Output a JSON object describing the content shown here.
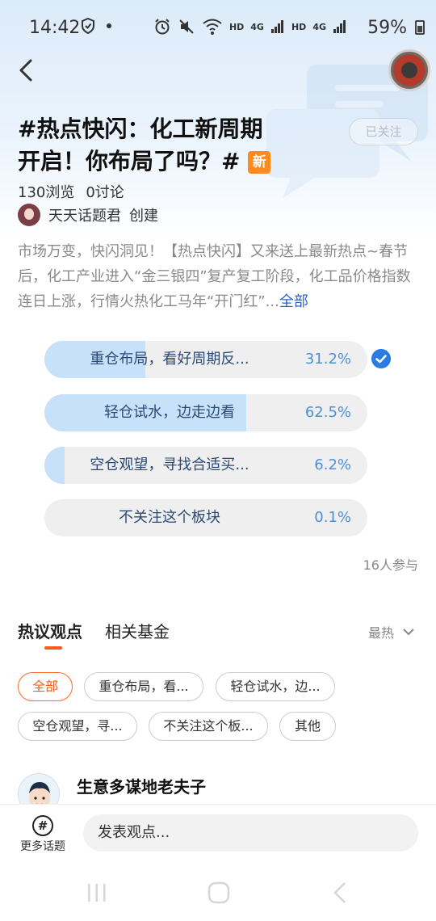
{
  "status_bar": {
    "time": "14:42",
    "hd1": "HD",
    "lte1": "4G",
    "hd2": "HD",
    "lte2": "4G",
    "battery": "59%"
  },
  "topic": {
    "title_line1": "#热点快闪：化工新周期",
    "title_line2": "开启！你布局了吗？#",
    "new_badge": "新",
    "follow_label": "已关注",
    "views": "130浏览",
    "discussions": "0讨论",
    "creator_name": "天天话题君",
    "creator_action": "创建",
    "description": "市场万变，快闪洞见！【热点快闪】又来送上最新热点~春节后，化工产业进入“金三银四”复产复工阶段，化工品价格指数连日上涨，行情火热化工马年“开门红”...",
    "description_more": "全部"
  },
  "poll": {
    "options": [
      {
        "label": "重仓布局，看好周期反...",
        "percent_text": "31.2%",
        "fill": 0.312,
        "selected": true
      },
      {
        "label": "轻仓试水，边走边看",
        "percent_text": "62.5%",
        "fill": 0.625,
        "selected": false
      },
      {
        "label": "空仓观望，寻找合适买...",
        "percent_text": "6.2%",
        "fill": 0.062,
        "selected": false
      },
      {
        "label": "不关注这个板块",
        "percent_text": "0.1%",
        "fill": 0.001,
        "selected": false
      }
    ],
    "participants": "16人参与"
  },
  "tabs": {
    "items": [
      "热议观点",
      "相关基金"
    ],
    "active": 0,
    "sort_label": "最热"
  },
  "filters": [
    "全部",
    "重仓布局，看...",
    "轻仓试水，边...",
    "空仓观望，寻...",
    "不关注这个板...",
    "其他"
  ],
  "comment": {
    "author": "生意多谋地老夫子"
  },
  "bottom_bar": {
    "more_topics": "更多话题",
    "post_placeholder": "发表观点..."
  },
  "colors": {
    "accent_orange": "#ff5a1a",
    "poll_fill": "#c7e1fb",
    "poll_percent": "#4f8fd8",
    "link_blue": "#2a64c4"
  }
}
